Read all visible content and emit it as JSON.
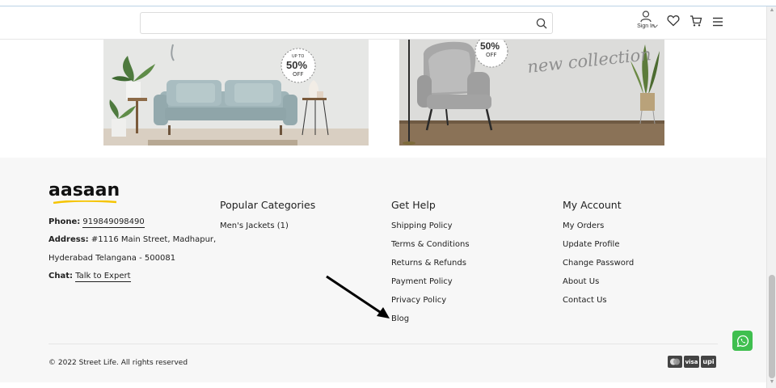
{
  "header": {
    "search_placeholder": "",
    "signin_label": "Sign In"
  },
  "banners": [
    {
      "badge_small": "UP TO",
      "badge_big": "50%",
      "badge_off": "OFF"
    },
    {
      "badge_big": "50%",
      "badge_off": "OFF",
      "script_text": "new collection"
    }
  ],
  "footer": {
    "logo": "aasaan",
    "phone_label": "Phone:",
    "phone_value": "919849098490",
    "address_label": "Address:",
    "address_line1": "#1116 Main Street, Madhapur,",
    "address_line2": "Hyderabad Telangana - 500081",
    "chat_label": "Chat:",
    "chat_link": "Talk to Expert",
    "popular_categories": {
      "title": "Popular Categories",
      "links": [
        "Men's Jackets (1)"
      ]
    },
    "get_help": {
      "title": "Get Help",
      "links": [
        "Shipping Policy",
        "Terms & Conditions",
        "Returns & Refunds",
        "Payment Policy",
        "Privacy Policy",
        "Blog"
      ]
    },
    "my_account": {
      "title": "My Account",
      "links": [
        "My Orders",
        "Update Profile",
        "Change Password",
        "About Us",
        "Contact Us"
      ]
    },
    "copyright": "© 2022 Street Life. All rights reserved",
    "payments": [
      "visa",
      "upi"
    ]
  },
  "colors": {
    "whatsapp": "#3fbf4f",
    "logo_accent": "#f5c400",
    "footer_bg": "#f7f7f7"
  }
}
